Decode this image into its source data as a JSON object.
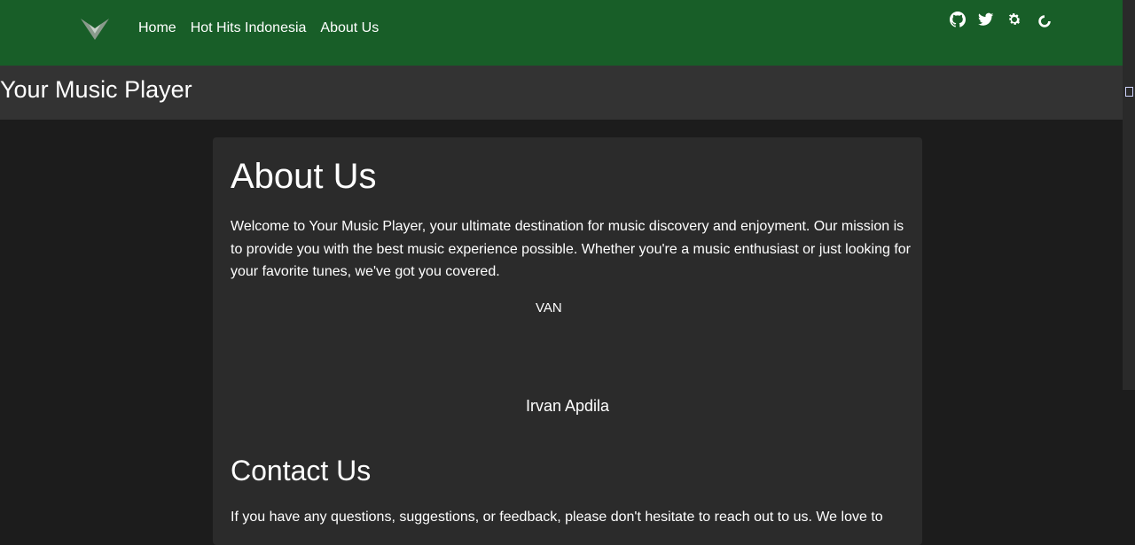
{
  "navbar": {
    "bg_color": "#185e28",
    "logo_icon": "v-logo-icon",
    "links": [
      {
        "label": "Home"
      },
      {
        "label": "Hot Hits Indonesia"
      },
      {
        "label": "About Us"
      }
    ],
    "icons": [
      "github-icon",
      "twitter-icon",
      "gear-icon",
      "spinner-icon"
    ]
  },
  "page": {
    "title": "Your Music Player"
  },
  "about": {
    "heading": "About Us",
    "paragraph": "Welcome to Your Music Player, your ultimate destination for music discovery and enjoyment. Our mission is to provide you with the best music experience possible. Whether you're a music enthusiast or just looking for your favorite tunes, we've got you covered.",
    "member": {
      "logo_text": "VAN",
      "name": "Irvan Apdila"
    }
  },
  "contact": {
    "heading": "Contact Us",
    "paragraph": "If you have any questions, suggestions, or feedback, please don't hesitate to reach out to us. We love to"
  }
}
